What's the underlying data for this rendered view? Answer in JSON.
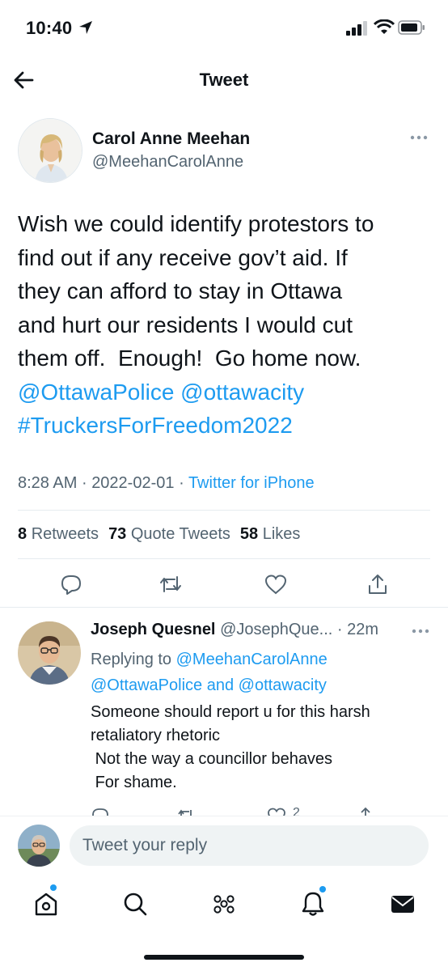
{
  "status_bar": {
    "time": "10:40",
    "icons": [
      "location-arrow-icon",
      "cellular-signal-icon",
      "wifi-icon",
      "battery-icon"
    ]
  },
  "header": {
    "title": "Tweet",
    "back_icon": "back-arrow-icon"
  },
  "tweet": {
    "author_name": "Carol Anne Meehan",
    "author_handle": "@MeehanCarolAnne",
    "text_lines": [
      "Wish we could identify protestors to",
      "find out if any receive gov’t aid. If",
      "they can afford to stay in Ottawa",
      "and hurt our residents I would cut",
      "them off.  Enough!  Go home now."
    ],
    "mention_1": "@OttawaPolice",
    "mention_2": "@ottawacity",
    "hashtag": "#TruckersForFreedom2022",
    "time": "8:28 AM",
    "date": "2022-02-01",
    "separator": "·",
    "source": "Twitter for iPhone",
    "retweets_count": "8",
    "retweets_label": "Retweets",
    "quotes_count": "73",
    "quotes_label": "Quote Tweets",
    "likes_count": "58",
    "likes_label": "Likes"
  },
  "reply": {
    "author_name": "Joseph Quesnel",
    "author_handle": "@JosephQue...",
    "separator": "·",
    "time_ago": "22m",
    "replying_prefix": "Replying to",
    "replying_to_1": "@MeehanCarolAnne",
    "replying_to_2": "@OttawaPolice",
    "replying_and": "and",
    "replying_to_3": "@ottawacity",
    "text": "Someone should report u for this harsh\nretaliatory rhetoric\n Not the way a councillor behaves\n For shame.",
    "likes_count": "2"
  },
  "composer": {
    "placeholder": "Tweet your reply"
  },
  "bottom_nav": {
    "items": [
      "home-icon",
      "search-icon",
      "spaces-icon",
      "notifications-icon",
      "messages-icon"
    ]
  },
  "colors": {
    "accent": "#1d9bf0",
    "text": "#0f1419",
    "secondary": "#536471"
  }
}
